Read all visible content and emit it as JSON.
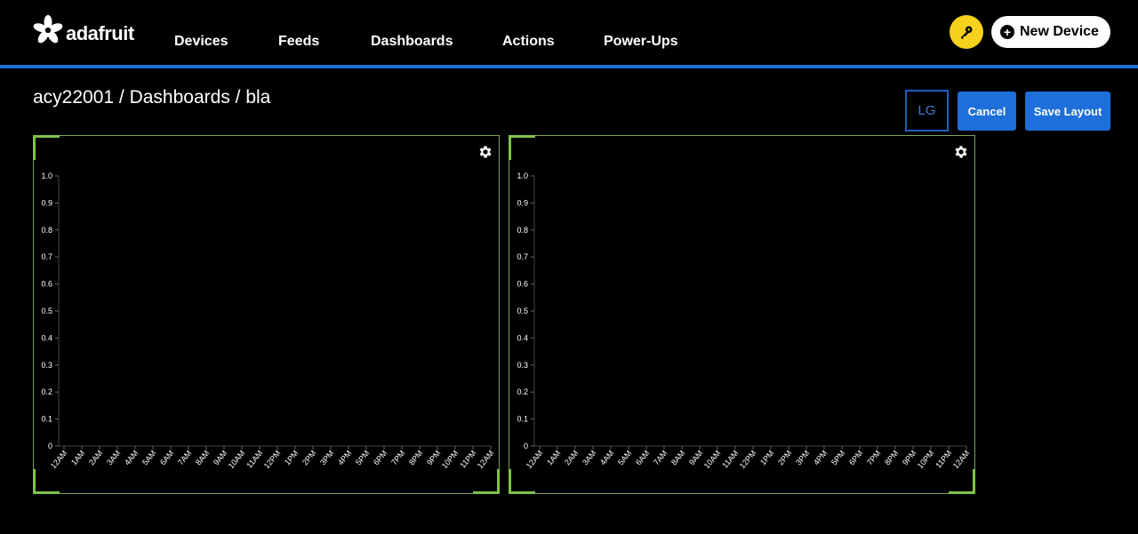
{
  "header": {
    "logo_text": "adafruit",
    "nav": [
      {
        "label": "Devices"
      },
      {
        "label": "Feeds"
      },
      {
        "label": "Dashboards"
      },
      {
        "label": "Actions"
      },
      {
        "label": "Power-Ups"
      }
    ],
    "new_device_label": "New Device",
    "accent_color": "#1e6fd9",
    "key_button_color": "#f6d21c"
  },
  "breadcrumb": "acy22001 / Dashboards / bla",
  "toolbar": {
    "size_label": "LG",
    "cancel_label": "Cancel",
    "save_label": "Save Layout"
  },
  "chart_data": [
    {
      "type": "line",
      "title": "",
      "xlabel": "",
      "ylabel": "",
      "ylim": [
        0,
        1.0
      ],
      "y_ticks": [
        "0",
        "0.1",
        "0.2",
        "0.3",
        "0.4",
        "0.5",
        "0.6",
        "0.7",
        "0.8",
        "0.9",
        "1.0"
      ],
      "x_ticks": [
        "12AM",
        "1AM",
        "2AM",
        "3AM",
        "4AM",
        "5AM",
        "6AM",
        "7AM",
        "8AM",
        "9AM",
        "10AM",
        "11AM",
        "12PM",
        "1PM",
        "2PM",
        "3PM",
        "4PM",
        "5PM",
        "6PM",
        "7PM",
        "8PM",
        "9PM",
        "10PM",
        "11PM",
        "12AM"
      ],
      "series": [],
      "grid": false
    },
    {
      "type": "line",
      "title": "",
      "xlabel": "",
      "ylabel": "",
      "ylim": [
        0,
        1.0
      ],
      "y_ticks": [
        "0",
        "0.1",
        "0.2",
        "0.3",
        "0.4",
        "0.5",
        "0.6",
        "0.7",
        "0.8",
        "0.9",
        "1.0"
      ],
      "x_ticks": [
        "12AM",
        "1AM",
        "2AM",
        "3AM",
        "4AM",
        "5AM",
        "6AM",
        "7AM",
        "8AM",
        "9AM",
        "10AM",
        "11AM",
        "12PM",
        "1PM",
        "2PM",
        "3PM",
        "4PM",
        "5PM",
        "6PM",
        "7PM",
        "8PM",
        "9PM",
        "10PM",
        "11PM",
        "12AM"
      ],
      "series": [],
      "grid": false
    }
  ]
}
